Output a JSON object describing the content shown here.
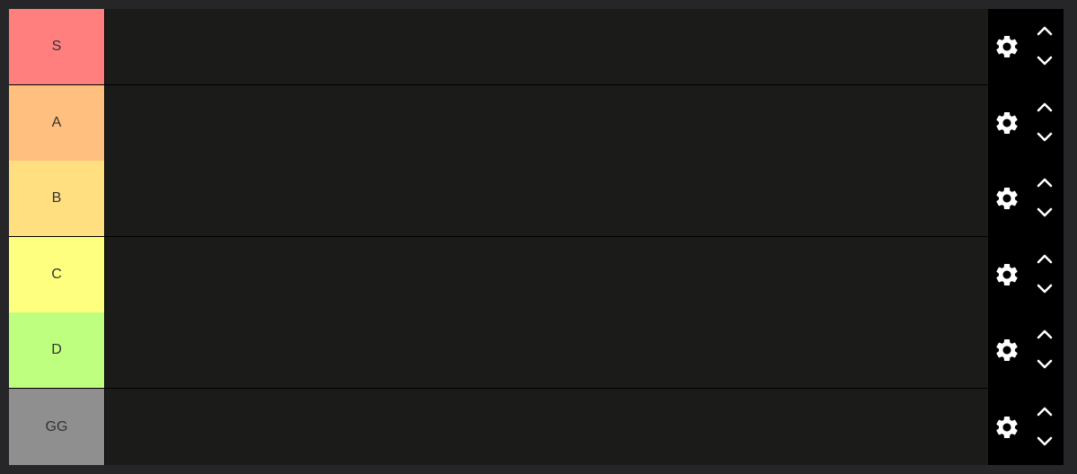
{
  "tiers": [
    {
      "label": "S",
      "color": "#ff7f7f"
    },
    {
      "label": "A",
      "color": "#ffbf7f"
    },
    {
      "label": "B",
      "color": "#ffdf7f"
    },
    {
      "label": "C",
      "color": "#ffff7f"
    },
    {
      "label": "D",
      "color": "#bfff7f"
    },
    {
      "label": "GG",
      "color": "#8f8f8f"
    }
  ],
  "icons": {
    "settings": "gear-icon",
    "move_up": "chevron-up-icon",
    "move_down": "chevron-down-icon"
  }
}
